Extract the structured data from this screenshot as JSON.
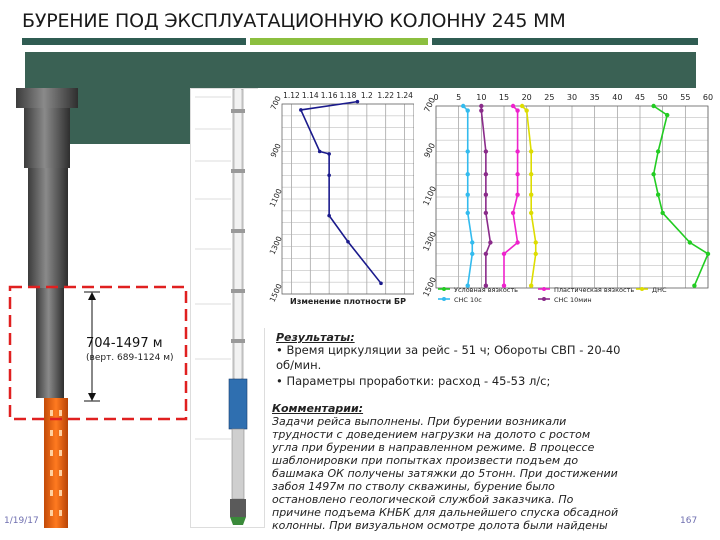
{
  "slide": {
    "title": "БУРЕНИЕ ПОД ЭКСПЛУАТАЦИОННУЮ КОЛОННУ 245 ММ",
    "accent_dark": "#2f5c52",
    "accent_green": "#8cbf3f",
    "date": "1/19/17",
    "page_number": "167"
  },
  "interval": {
    "label": "704-1497 м",
    "sub_label": "(верт. 689-1124 м)"
  },
  "results": {
    "heading": "Результаты:",
    "line1": "• Время циркуляции за рейс - 51 ч; Обороты СВП - 20-40",
    "line1b": "об/мин.",
    "line2": "• Параметры проработки: расход -  45-53 л/с;"
  },
  "comments": {
    "heading": "Комментарии:",
    "lines": [
      "Задачи рейса выполнены. При бурении возникали",
      "трудности с доведением нагрузки на долото с ростом",
      "угла при бурении в направленном режиме. В процессе",
      "шаблонировки при попытках произвести подъем до",
      "башмака ОК получены затяжки до 5тонн. При достижении",
      "забоя 1497м по стволу скважины, бурение было",
      "остановлено геологической службой заказчика. По",
      "причине подъема КНБК для дальнейшего спуска обсадной",
      "колонны. При визуальном осмотре долота были найдены"
    ]
  },
  "chart_data": [
    {
      "type": "line",
      "title": "Изменение плотности БР",
      "x_ticks": [
        "1.12",
        "1.14",
        "1.16",
        "1.18",
        "1.2",
        "1.22",
        "1.24"
      ],
      "xlim": [
        1.11,
        1.25
      ],
      "y_ticks": [
        "700",
        "900",
        "1100",
        "1300",
        "1500"
      ],
      "ylim": [
        700,
        1500
      ],
      "y_inverted": true,
      "series": [
        {
          "color": "#1a1a8c",
          "x": [
            1.19,
            1.13,
            1.15,
            1.16,
            1.16,
            1.16,
            1.18,
            1.215
          ],
          "y": [
            690,
            725,
            900,
            910,
            1000,
            1170,
            1280,
            1455
          ]
        }
      ]
    },
    {
      "type": "line",
      "x_ticks": [
        "0",
        "5",
        "10",
        "15",
        "20",
        "25",
        "30",
        "35",
        "40",
        "45",
        "50",
        "55",
        "60"
      ],
      "xlim": [
        0,
        60
      ],
      "y_ticks": [
        "700",
        "900",
        "1100",
        "1300",
        "1500"
      ],
      "ylim": [
        700,
        1500
      ],
      "y_inverted": true,
      "series": [
        {
          "name": "Условная вязкость",
          "color": "#22cc22",
          "x": [
            48,
            51,
            49,
            48,
            49,
            50,
            56,
            60,
            57
          ],
          "y": [
            700,
            740,
            900,
            1000,
            1090,
            1170,
            1300,
            1350,
            1490
          ]
        },
        {
          "name": "Пластическая вязкость",
          "color": "#ee22cc",
          "x": [
            17,
            18,
            18,
            18,
            18,
            17,
            18,
            15,
            15
          ],
          "y": [
            700,
            720,
            900,
            1000,
            1090,
            1170,
            1300,
            1350,
            1490
          ]
        },
        {
          "name": "ДНС",
          "color": "#dddd00",
          "x": [
            19,
            20,
            21,
            21,
            21,
            21,
            22,
            22,
            21
          ],
          "y": [
            700,
            720,
            900,
            1000,
            1090,
            1170,
            1300,
            1350,
            1490
          ]
        },
        {
          "name": "СНС 10с",
          "color": "#33bbee",
          "x": [
            6,
            7,
            7,
            7,
            7,
            7,
            8,
            8,
            7
          ],
          "y": [
            700,
            720,
            900,
            1000,
            1090,
            1170,
            1300,
            1350,
            1490
          ]
        },
        {
          "name": "СНС 10мин",
          "color": "#8a2b8a",
          "x": [
            10,
            10,
            11,
            11,
            11,
            11,
            12,
            11,
            11
          ],
          "y": [
            700,
            720,
            900,
            1000,
            1090,
            1170,
            1300,
            1350,
            1490
          ]
        }
      ]
    }
  ]
}
